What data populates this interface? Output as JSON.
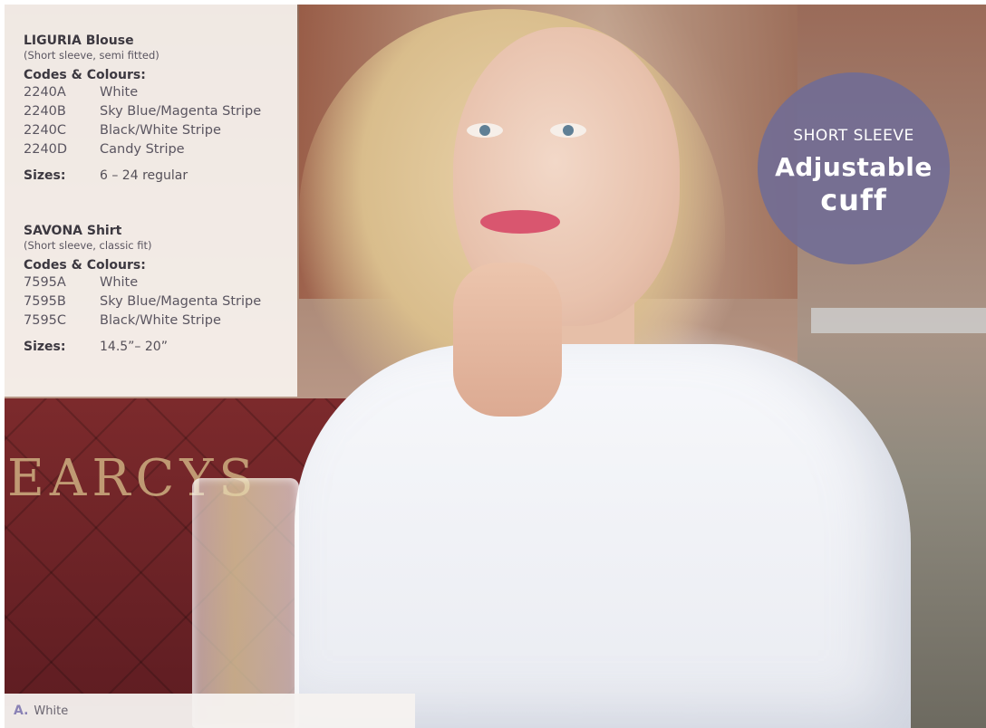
{
  "products": [
    {
      "name": "LIGURIA Blouse",
      "subtitle": "(Short sleeve, semi fitted)",
      "codes_heading": "Codes & Colours:",
      "codes": [
        {
          "code": "2240A",
          "colour": "White"
        },
        {
          "code": "2240B",
          "colour": "Sky Blue/Magenta Stripe"
        },
        {
          "code": "2240C",
          "colour": "Black/White Stripe"
        },
        {
          "code": "2240D",
          "colour": "Candy Stripe"
        }
      ],
      "sizes_label": "Sizes:",
      "sizes_value": "6 – 24 regular"
    },
    {
      "name": "SAVONA Shirt",
      "subtitle": "(Short sleeve, classic fit)",
      "codes_heading": "Codes & Colours:",
      "codes": [
        {
          "code": "7595A",
          "colour": "White"
        },
        {
          "code": "7595B",
          "colour": "Sky Blue/Magenta Stripe"
        },
        {
          "code": "7595C",
          "colour": "Black/White Stripe"
        }
      ],
      "sizes_label": "Sizes:",
      "sizes_value": "14.5”– 20”"
    }
  ],
  "badge": {
    "line1": "SHORT SLEEVE",
    "line2": "Adjustable",
    "line3": "cuff",
    "color": "#706c96"
  },
  "sign_text": "EARCYS",
  "caption": {
    "letter": "A.",
    "text": "White"
  }
}
